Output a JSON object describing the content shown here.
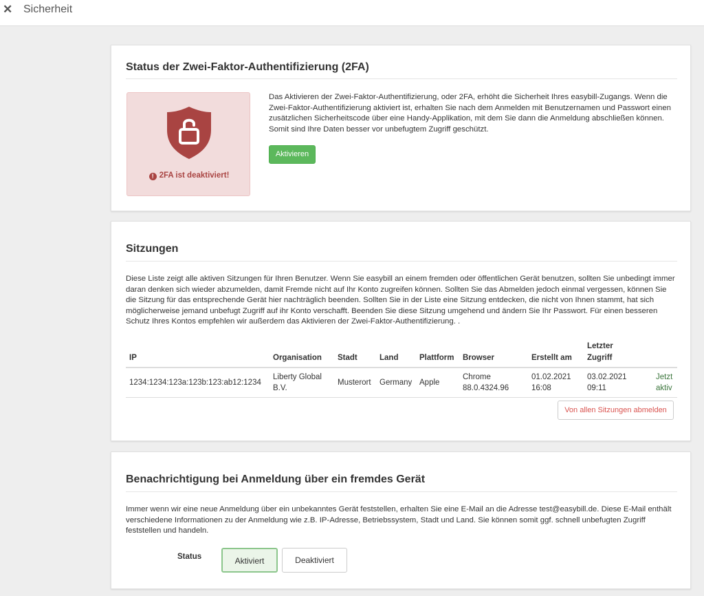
{
  "topbar": {
    "close_symbol": "✕",
    "title": "Sicherheit"
  },
  "twofa": {
    "title": "Status der Zwei-Faktor-Authentifizierung (2FA)",
    "status_text": "2FA ist deaktiviert!",
    "description": "Das Aktivieren der Zwei-Faktor-Authentifizierung, oder 2FA, erhöht die Sicherheit Ihres easybill-Zugangs. Wenn die Zwei-Faktor-Authentifizierung aktiviert ist, erhalten Sie nach dem Anmelden mit Benutzernamen und Passwort einen zusätzlichen Sicherheitscode über eine Handy-Applikation, mit dem Sie dann die Anmeldung abschließen können. Somit sind Ihre Daten besser vor unbefugtem Zugriff geschützt.",
    "activate_label": "Aktivieren",
    "colors": {
      "box_bg": "#f2dcdc",
      "shield": "#a94442",
      "button": "#5cb85c"
    },
    "icons": {
      "status": "shield-unlocked-icon",
      "warning": "exclamation-circle-icon"
    }
  },
  "sessions": {
    "title": "Sitzungen",
    "description": "Diese Liste zeigt alle aktiven Sitzungen für Ihren Benutzer. Wenn Sie easybill an einem fremden oder öffentlichen Gerät benutzen, sollten Sie unbedingt immer daran denken sich wieder abzumelden, damit Fremde nicht auf Ihr Konto zugreifen können. Sollten Sie das Abmelden jedoch einmal vergessen, können Sie die Sitzung für das entsprechende Gerät hier nachträglich beenden. Sollten Sie in der Liste eine Sitzung entdecken, die nicht von Ihnen stammt, hat sich möglicherweise jemand unbefugt Zugriff auf ihr Konto verschafft. Beenden Sie diese Sitzung umgehend und ändern Sie Ihr Passwort. Für einen besseren Schutz Ihres Kontos empfehlen wir außerdem das Aktivieren der Zwei-Faktor-Authentifizierung. .",
    "columns": {
      "ip": "IP",
      "org": "Organisation",
      "city": "Stadt",
      "country": "Land",
      "platform": "Plattform",
      "browser": "Browser",
      "created": "Erstellt am",
      "last_line1": "Letzter",
      "last_line2": "Zugriff"
    },
    "rows": [
      {
        "ip": "1234:1234:123a:123b:123:ab12:1234",
        "org_line1": "Liberty Global",
        "org_line2": "B.V.",
        "city": "Musterort",
        "country": "Germany",
        "platform": "Apple",
        "browser_line1": "Chrome",
        "browser_line2": "88.0.4324.96",
        "created_line1": "01.02.2021",
        "created_line2": "16:08",
        "last_line1": "03.02.2021",
        "last_line2": "09:11",
        "status_line1": "Jetzt",
        "status_line2": "aktiv"
      }
    ],
    "logout_all_label": "Von allen Sitzungen abmelden"
  },
  "notify": {
    "title": "Benachrichtigung bei Anmeldung über ein fremdes Gerät",
    "description": "Immer wenn wir eine neue Anmeldung über ein unbekanntes Gerät feststellen, erhalten Sie eine E-Mail an die Adresse test@easybill.de. Diese E-Mail enthält verschiedene Informationen zu der Anmeldung wie z.B. IP-Adresse, Betriebssystem, Stadt und Land. Sie können somit ggf. schnell unbefugten Zugriff feststellen und handeln.",
    "status_label": "Status",
    "options": [
      "Aktiviert",
      "Deaktiviert"
    ],
    "selected": "Aktiviert"
  }
}
